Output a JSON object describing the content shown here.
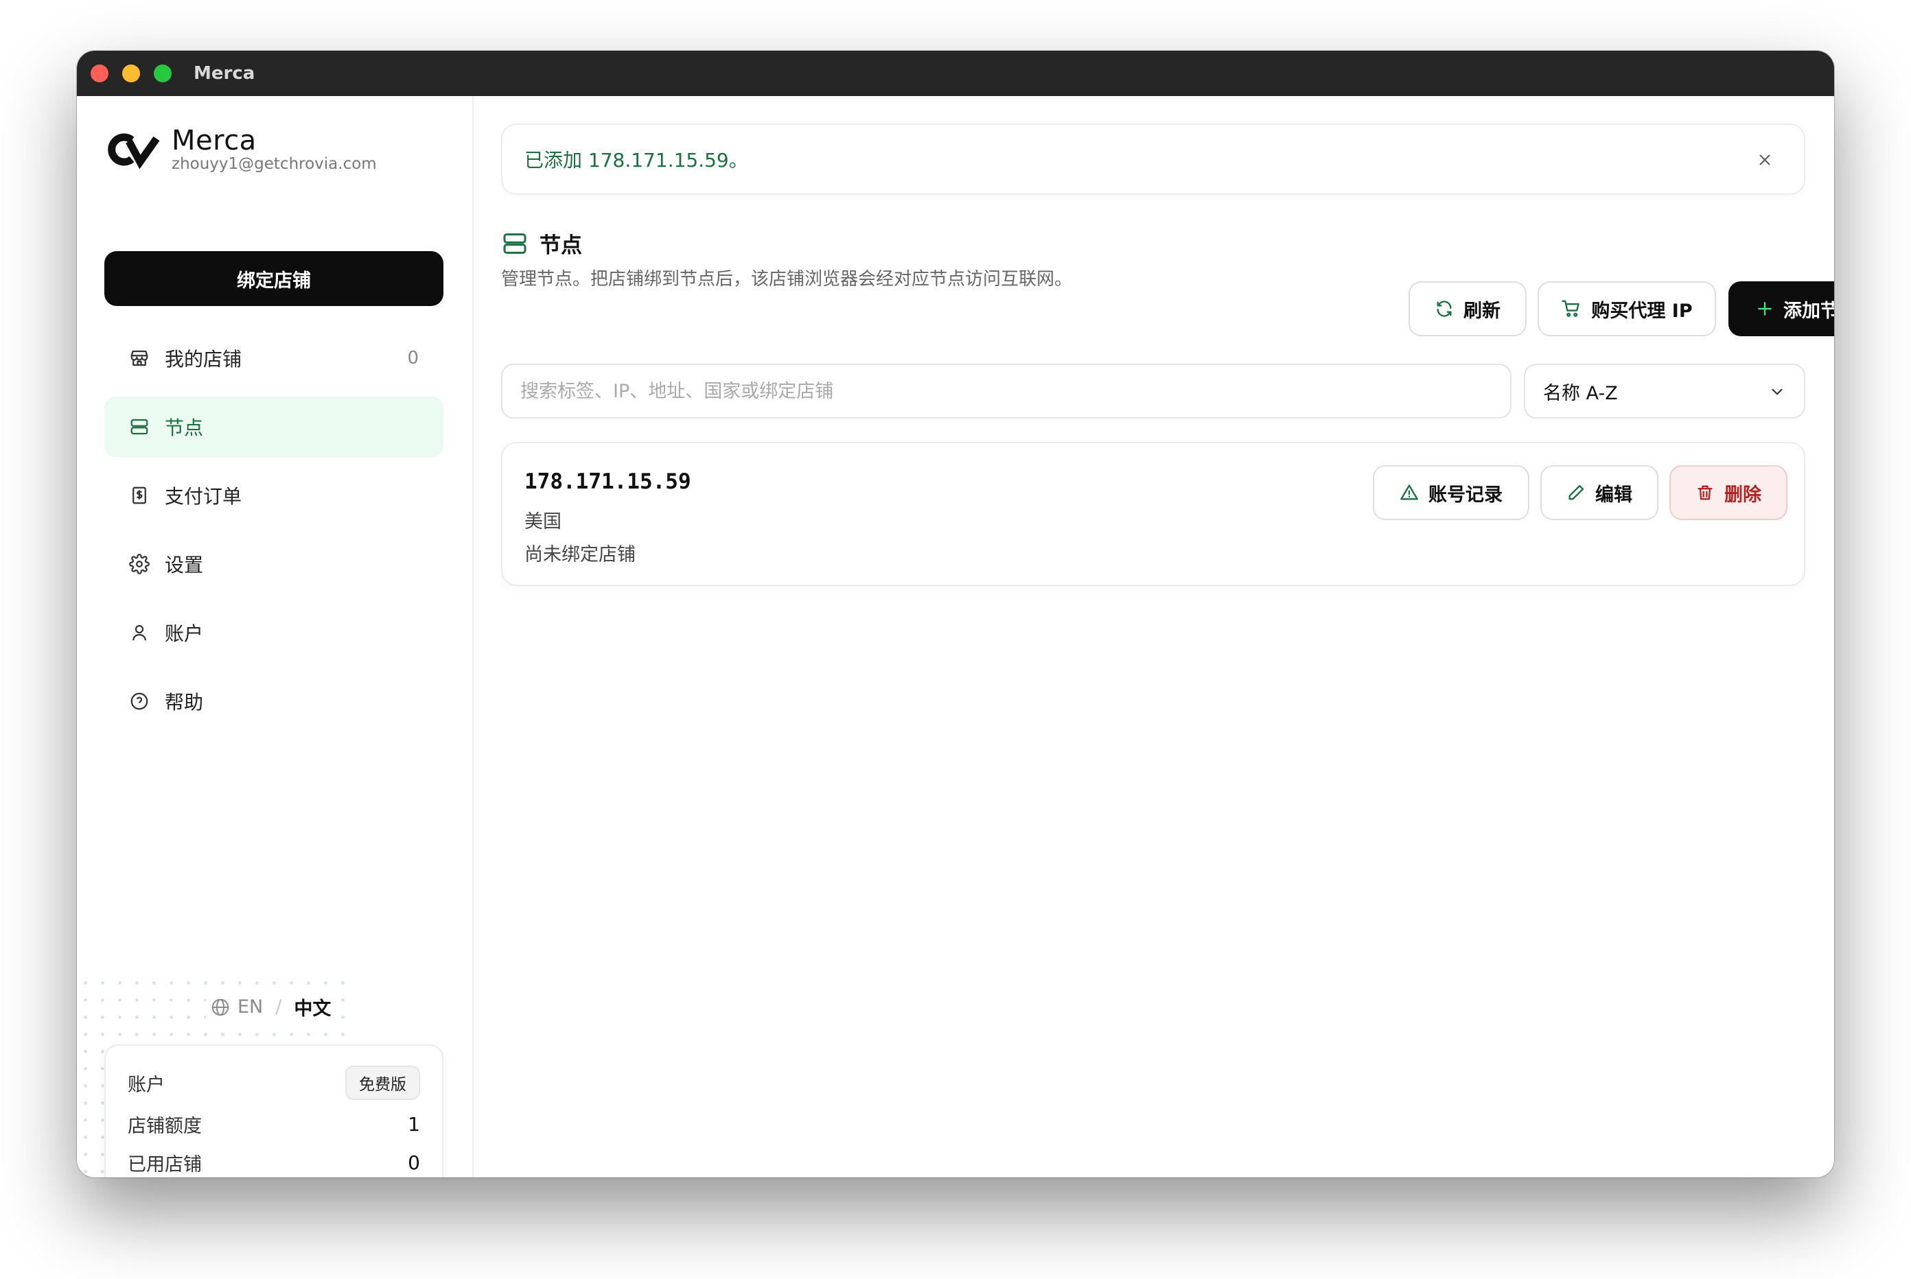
{
  "window": {
    "title": "Merca"
  },
  "brand": {
    "name": "Merca",
    "email": "zhouyy1@getchrovia.com"
  },
  "sidebar": {
    "bind_button": "绑定店铺",
    "items": [
      {
        "label": "我的店铺",
        "count": "0",
        "icon": "store-icon"
      },
      {
        "label": "节点",
        "icon": "server-icon",
        "active": true
      },
      {
        "label": "支付订单",
        "icon": "receipt-icon"
      },
      {
        "label": "设置",
        "icon": "gear-icon"
      },
      {
        "label": "账户",
        "icon": "user-icon"
      },
      {
        "label": "帮助",
        "icon": "help-circle-icon"
      }
    ],
    "language": {
      "en": "EN",
      "separator": "/",
      "zh": "中文"
    },
    "account_card": {
      "label": "账户",
      "plan_badge": "免费版",
      "quota_label": "店铺额度",
      "quota_value": "1",
      "used_label": "已用店铺",
      "used_value": "0"
    }
  },
  "main": {
    "toast": {
      "message": "已添加 178.171.15.59。"
    },
    "header": {
      "title": "节点",
      "description": "管理节点。把店铺绑到节点后，该店铺浏览器会经对应节点访问互联网。"
    },
    "actions": {
      "refresh": "刷新",
      "buy_proxy": "购买代理 IP",
      "add_node": "添加节点"
    },
    "search": {
      "placeholder": "搜索标签、IP、地址、国家或绑定店铺",
      "value": ""
    },
    "sort": {
      "selected": "名称 A-Z"
    },
    "nodes": [
      {
        "ip": "178.171.15.59",
        "country": "美国",
        "status": "尚未绑定店铺",
        "actions": {
          "history": "账号记录",
          "edit": "编辑",
          "delete": "删除"
        }
      }
    ]
  },
  "colors": {
    "accent_green": "#1b6f41",
    "active_bg": "#ecfbf1",
    "danger": "#b42323",
    "danger_bg": "#fdeeee",
    "titlebar": "#262626",
    "primary_button": "#0d0d0d"
  }
}
